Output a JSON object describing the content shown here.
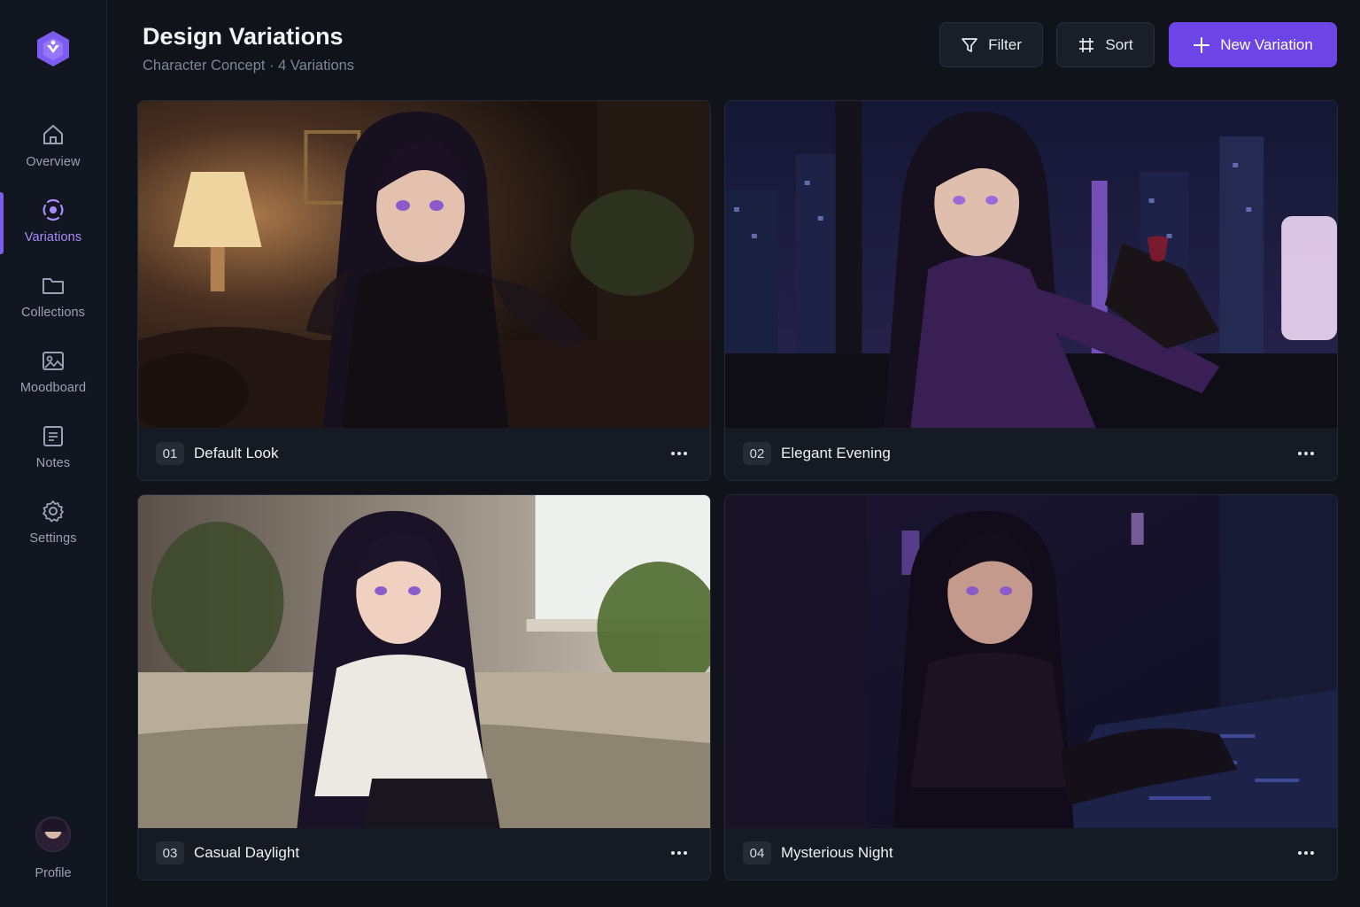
{
  "app": {
    "logo_icon": "hexagon-logo-icon",
    "accent_color": "#6d45e6"
  },
  "sidebar": {
    "items": [
      {
        "label": "Overview",
        "icon": "home-icon",
        "active": false
      },
      {
        "label": "Variations",
        "icon": "variations-icon",
        "active": true
      },
      {
        "label": "Collections",
        "icon": "folder-icon",
        "active": false
      },
      {
        "label": "Moodboard",
        "icon": "moodboard-icon",
        "active": false
      },
      {
        "label": "Notes",
        "icon": "notes-icon",
        "active": false
      },
      {
        "label": "Settings",
        "icon": "gear-icon",
        "active": false
      }
    ],
    "profile": {
      "label": "Profile",
      "icon": "avatar"
    }
  },
  "header": {
    "title": "Design Variations",
    "subtitle": "Character Concept · 4 Variations",
    "filter_label": "Filter",
    "sort_label": "Sort",
    "new_label": "New Variation"
  },
  "variations": [
    {
      "number": "01",
      "name": "Default Look",
      "scene": "warm lamp-lit lounge"
    },
    {
      "number": "02",
      "name": "Elegant Evening",
      "scene": "night city window with wine glass"
    },
    {
      "number": "03",
      "name": "Casual Daylight",
      "scene": "bright window with plants and sofa"
    },
    {
      "number": "04",
      "name": "Mysterious Night",
      "scene": "dark rainy alley"
    }
  ]
}
